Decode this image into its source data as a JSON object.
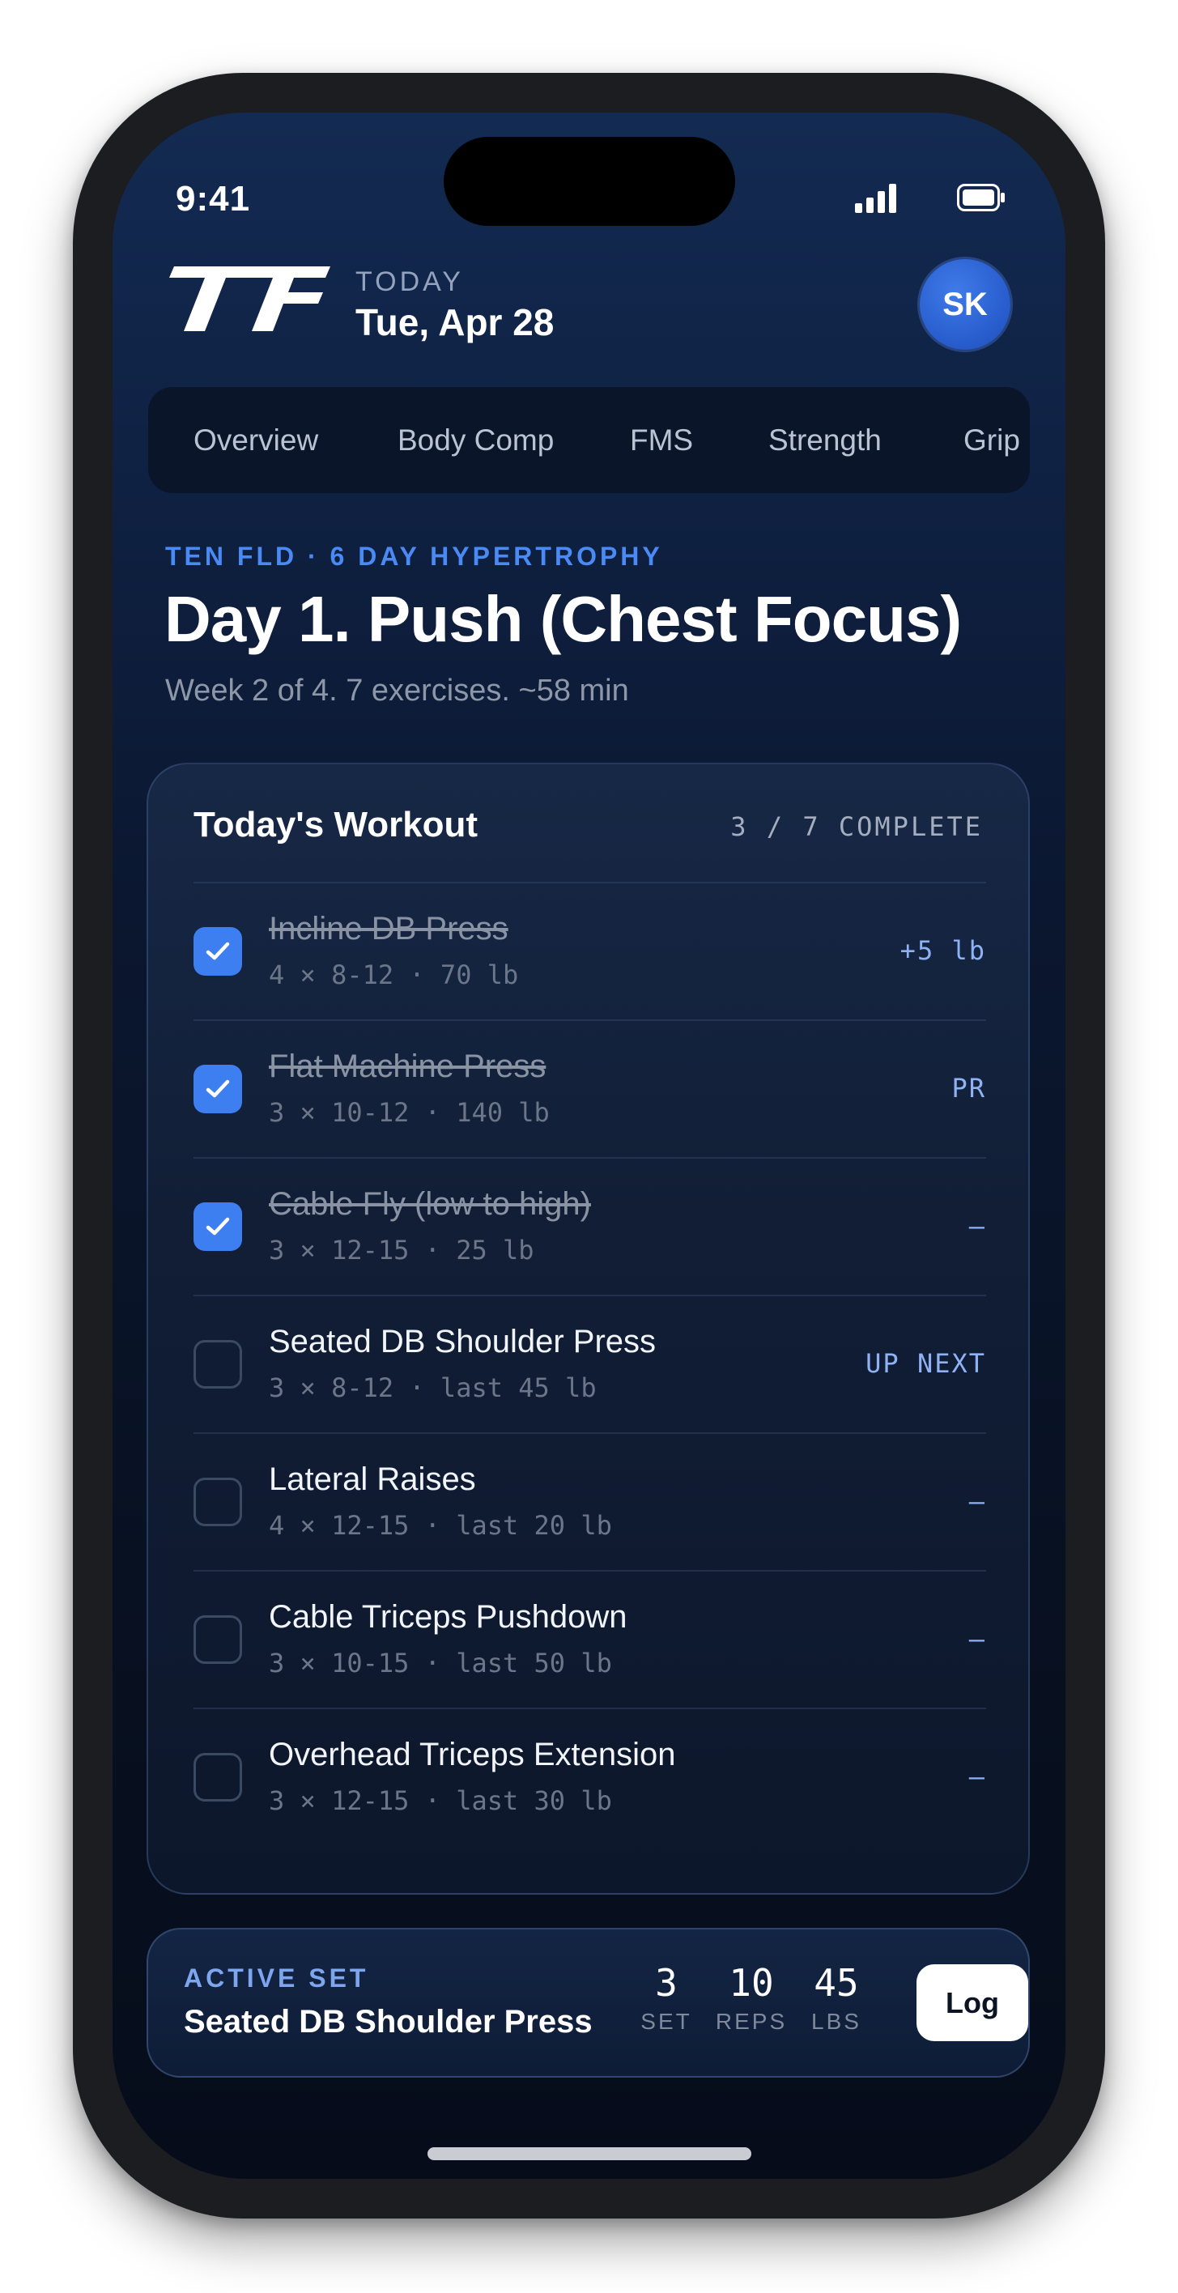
{
  "status_bar": {
    "time": "9:41"
  },
  "header": {
    "logo_text": "TF",
    "today_label": "TODAY",
    "date": "Tue, Apr 28",
    "avatar_initials": "SK"
  },
  "tabs": [
    {
      "label": "Overview"
    },
    {
      "label": "Body Comp"
    },
    {
      "label": "FMS"
    },
    {
      "label": "Strength"
    },
    {
      "label": "Grip"
    }
  ],
  "program": {
    "label": "TEN FLD · 6 DAY HYPERTROPHY",
    "title": "Day 1. Push (Chest Focus)",
    "subtitle": "Week 2 of 4. 7 exercises. ~58 min"
  },
  "workout": {
    "title": "Today's Workout",
    "progress": "3 / 7 COMPLETE",
    "exercises": [
      {
        "name": "Incline DB Press",
        "detail": "4 × 8-12 · 70 lb",
        "tag": "+5 lb",
        "done": true
      },
      {
        "name": "Flat Machine Press",
        "detail": "3 × 10-12 · 140 lb",
        "tag": "PR",
        "done": true
      },
      {
        "name": "Cable Fly (low to high)",
        "detail": "3 × 12-15 · 25 lb",
        "tag": "–",
        "done": true
      },
      {
        "name": "Seated DB Shoulder Press",
        "detail": "3 × 8-12 · last 45 lb",
        "tag": "UP NEXT",
        "done": false
      },
      {
        "name": "Lateral Raises",
        "detail": "4 × 12-15 · last 20 lb",
        "tag": "–",
        "done": false
      },
      {
        "name": "Cable Triceps Pushdown",
        "detail": "3 × 10-15 · last 50 lb",
        "tag": "–",
        "done": false
      },
      {
        "name": "Overhead Triceps Extension",
        "detail": "3 × 12-15 · last 30 lb",
        "tag": "–",
        "done": false
      }
    ]
  },
  "active_set": {
    "label": "ACTIVE SET",
    "exercise": "Seated DB Shoulder Press",
    "set_value": "3",
    "set_unit": "SET",
    "reps_value": "10",
    "reps_unit": "REPS",
    "lbs_value": "45",
    "lbs_unit": "LBS",
    "log_label": "Log"
  },
  "colors": {
    "accent": "#3d7ff0",
    "background_top": "#132a52",
    "background_bottom": "#060c1a",
    "tag_text": "#8fb2f5"
  }
}
